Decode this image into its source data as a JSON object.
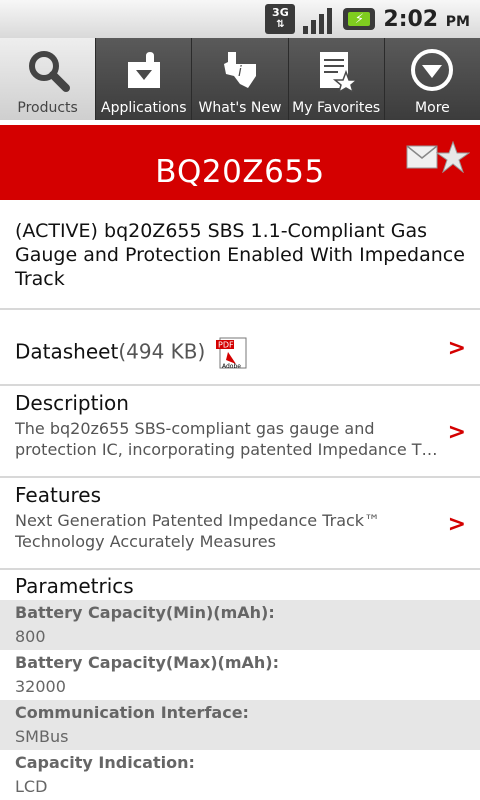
{
  "status_bar": {
    "network": "3G",
    "time": "2:02",
    "ampm": "PM"
  },
  "tabs": [
    {
      "label": "Products",
      "icon": "search-icon",
      "active": true
    },
    {
      "label": "Applications",
      "icon": "puzzle-icon",
      "active": false
    },
    {
      "label": "What's New",
      "icon": "texas-icon",
      "active": false
    },
    {
      "label": "My Favorites",
      "icon": "favorites-list-icon",
      "active": false
    },
    {
      "label": "More",
      "icon": "chevron-down-circle-icon",
      "active": false
    }
  ],
  "product": {
    "title": "BQ20Z655",
    "summary": "(ACTIVE) bq20Z655 SBS 1.1-Compliant Gas Gauge and Protection Enabled With Impedance Track"
  },
  "datasheet": {
    "label": "Datasheet",
    "size": "(494 KB)",
    "pdf_badge": "PDF",
    "pdf_brand": "Adobe"
  },
  "description": {
    "label": "Description",
    "line1": "The bq20z655 SBS-compliant gas gauge and",
    "line2": "protection IC, incorporating patented Impedance T…"
  },
  "features": {
    "label": "Features",
    "line1": "Next Generation Patented Impedance Track™",
    "line2": "Technology Accurately Measures"
  },
  "parametrics": {
    "label": "Parametrics",
    "items": [
      {
        "name": "Battery Capacity(Min)(mAh):",
        "value": "800"
      },
      {
        "name": "Battery Capacity(Max)(mAh):",
        "value": "32000"
      },
      {
        "name": "Communication Interface:",
        "value": "SMBus"
      },
      {
        "name": "Capacity Indication:",
        "value": "LCD"
      }
    ]
  },
  "chevron": ">",
  "colors": {
    "brand_red": "#d40000",
    "tab_dark": "#4a4a4a",
    "tab_active": "#e0e0e0"
  }
}
